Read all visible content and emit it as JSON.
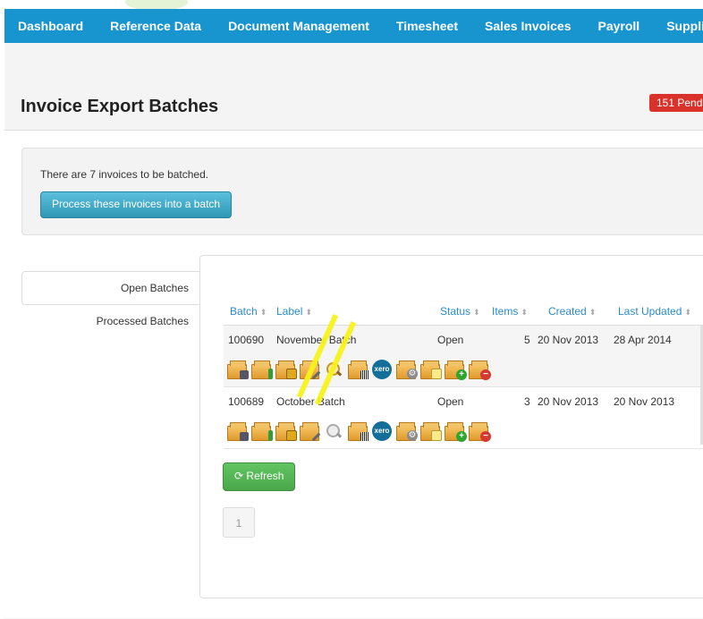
{
  "nav": {
    "items": [
      "Dashboard",
      "Reference Data",
      "Document Management",
      "Timesheet",
      "Sales Invoices",
      "Payroll",
      "Supplier P"
    ]
  },
  "page": {
    "title": "Invoice Export Batches",
    "pending_badge": "151 Pend"
  },
  "notice": {
    "text": "There are 7 invoices to be batched.",
    "process_button": "Process these invoices into a batch"
  },
  "tabs": [
    {
      "label": "Open Batches",
      "active": true
    },
    {
      "label": "Processed Batches",
      "active": false
    }
  ],
  "table": {
    "columns": [
      "Batch",
      "Label",
      "Status",
      "Items",
      "Created",
      "Last Updated"
    ],
    "sort_glyph": "⬍",
    "rows": [
      {
        "batch": "100690",
        "label": "November Batch",
        "status": "Open",
        "items": "5",
        "created": "20 Nov 2013",
        "updated": "28 Apr 2014"
      },
      {
        "batch": "100689",
        "label": "October Batch",
        "status": "Open",
        "items": "3",
        "created": "20 Nov 2013",
        "updated": "20 Nov 2013"
      }
    ]
  },
  "action_icons": [
    "calculator-box-icon",
    "export-box-icon",
    "lock-box-icon",
    "edit-box-icon",
    "search-icon",
    "barcode-box-icon",
    "xero-icon",
    "settings-box-icon",
    "note-box-icon",
    "add-box-icon",
    "remove-box-icon"
  ],
  "xero_text": "xero",
  "refresh_button": "Refresh",
  "refresh_glyph": "⟳",
  "pagination": {
    "current": "1"
  },
  "colors": {
    "nav": "#1895cf",
    "process_button": "#2f96b4",
    "refresh_button": "#4aa84a",
    "badge": "#d9322a",
    "link": "#2a8bc9",
    "xero": "#136f9a"
  }
}
